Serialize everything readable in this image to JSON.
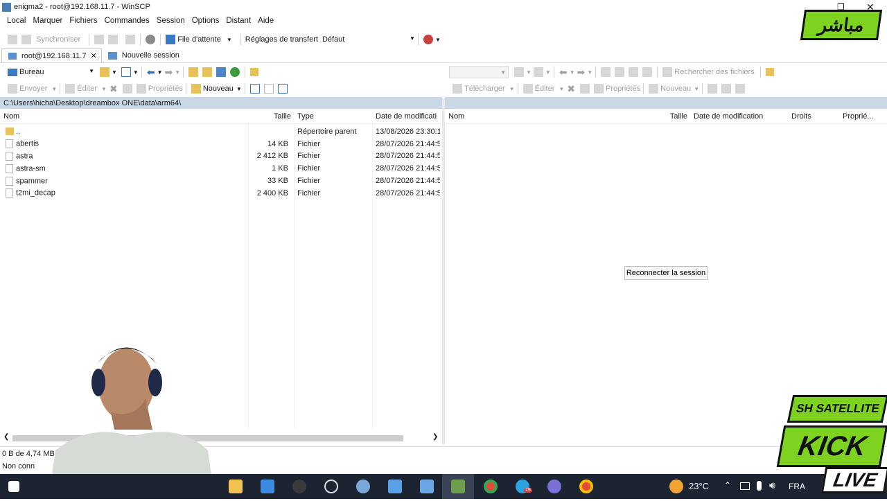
{
  "window": {
    "title": "enigma2 - root@192.168.11.7 - WinSCP"
  },
  "menu": [
    "Local",
    "Marquer",
    "Fichiers",
    "Commandes",
    "Session",
    "Options",
    "Distant",
    "Aide"
  ],
  "toolbar": {
    "synchronize": "Synchroniser",
    "queue": "File d'attente",
    "transfer_settings_label": "Réglages de transfert",
    "transfer_settings_value": "Défaut"
  },
  "tabs": [
    {
      "label": "root@192.168.11.7"
    },
    {
      "label": "Nouvelle session"
    }
  ],
  "local": {
    "drive": "Bureau",
    "actions": {
      "upload": "Envoyer",
      "edit": "Éditer",
      "properties": "Propriétés",
      "new": "Nouveau"
    },
    "path": "C:\\Users\\hicha\\Desktop\\dreambox ONE\\data\\arm64\\",
    "columns": [
      "Nom",
      "Taille",
      "Type",
      "Date de modificati"
    ],
    "rows": [
      {
        "name": "..",
        "size": "",
        "type": "Répertoire parent",
        "date": "13/08/2026  23:30:1"
      },
      {
        "name": "abertis",
        "size": "14 KB",
        "type": "Fichier",
        "date": "28/07/2026  21:44:5"
      },
      {
        "name": "astra",
        "size": "2 412 KB",
        "type": "Fichier",
        "date": "28/07/2026  21:44:5"
      },
      {
        "name": "astra-sm",
        "size": "1 KB",
        "type": "Fichier",
        "date": "28/07/2026  21:44:5"
      },
      {
        "name": "spammer",
        "size": "33 KB",
        "type": "Fichier",
        "date": "28/07/2026  21:44:5"
      },
      {
        "name": "t2mi_decap",
        "size": "2 400 KB",
        "type": "Fichier",
        "date": "28/07/2026  21:44:5"
      }
    ]
  },
  "remote": {
    "find_files": "Rechercher des fichiers",
    "actions": {
      "download": "Télécharger",
      "edit": "Éditer",
      "properties": "Propriétés",
      "new": "Nouveau"
    },
    "columns": [
      "Nom",
      "Taille",
      "Date de modification",
      "Droits",
      "Proprié..."
    ],
    "reconnect": "Reconnecter la session"
  },
  "status": {
    "line1": "0 B de 4,74 MB",
    "line2": "Non conn"
  },
  "taskbar": {
    "weather": "23°C",
    "lang": "FRA",
    "badge": "29"
  },
  "overlay": {
    "live_badge": "مباشر",
    "brand": "SH SATELLITE",
    "kick": "KICK",
    "live": "LIVE"
  }
}
